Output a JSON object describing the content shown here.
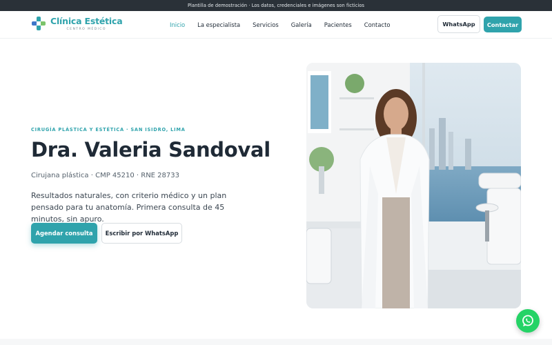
{
  "banner": {
    "text": "Plantilla de demostración · Los datos, credenciales e imágenes son ficticios"
  },
  "brand": {
    "name": "Clínica Estética",
    "tagline": "CENTRO MÉDICO",
    "accent": "#2fa3ac",
    "logo_icon": "medical-cross-icon"
  },
  "nav": {
    "items": [
      {
        "label": "Inicio",
        "active": true
      },
      {
        "label": "La especialista"
      },
      {
        "label": "Servicios"
      },
      {
        "label": "Galería"
      },
      {
        "label": "Pacientes"
      },
      {
        "label": "Contacto"
      }
    ],
    "whatsapp_label": "WhatsApp",
    "contact_label": "Contactar"
  },
  "hero": {
    "eyebrow": "CIRUGÍA PLÁSTICA Y ESTÉTICA · SAN ISIDRO, LIMA",
    "title": "Dra. Valeria Sandoval",
    "meta": "Cirujana plástica · CMP 45210 · RNE 28733",
    "description": "Resultados naturales, con criterio médico y un plan pensado para tu anatomía. Primera consulta de 45 minutos, sin apuro.",
    "primary_cta": "Agendar consulta",
    "secondary_cta": "Escribir por WhatsApp",
    "image_subject": "doctor-in-clinic-photo"
  },
  "floating": {
    "icon": "whatsapp-icon",
    "color": "#25d366"
  }
}
